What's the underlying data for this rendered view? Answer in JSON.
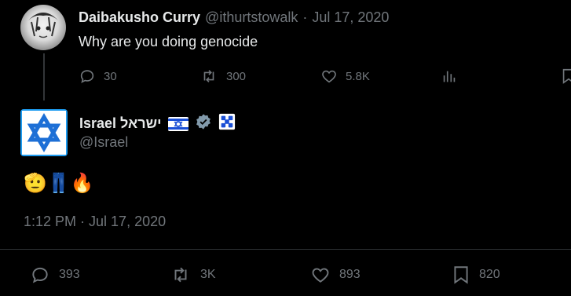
{
  "reply_tweet": {
    "author_name": "Daibakusho Curry",
    "handle": "@ithurtstowalk",
    "separator": "·",
    "date": "Jul 17, 2020",
    "text": "Why are you doing genocide",
    "replies": "30",
    "retweets": "300",
    "likes": "5.8K"
  },
  "main_tweet": {
    "author_name": "Israel ישראל",
    "handle": "@Israel",
    "emoji_text": "🫡👖🔥",
    "timestamp": "1:12 PM · Jul 17, 2020",
    "replies": "393",
    "retweets": "3K",
    "likes": "893",
    "bookmarks": "820"
  },
  "colors": {
    "background": "#000000",
    "primary_text": "#e7e9ea",
    "secondary_text": "#71767b",
    "verified_badge": "#829aab",
    "brand_blue": "#1d9bf0"
  },
  "icons": [
    "reply-icon",
    "retweet-icon",
    "like-icon",
    "views-icon",
    "bookmark-icon",
    "verified-badge-icon",
    "israel-flag-icon",
    "affiliate-emblem-icon"
  ]
}
